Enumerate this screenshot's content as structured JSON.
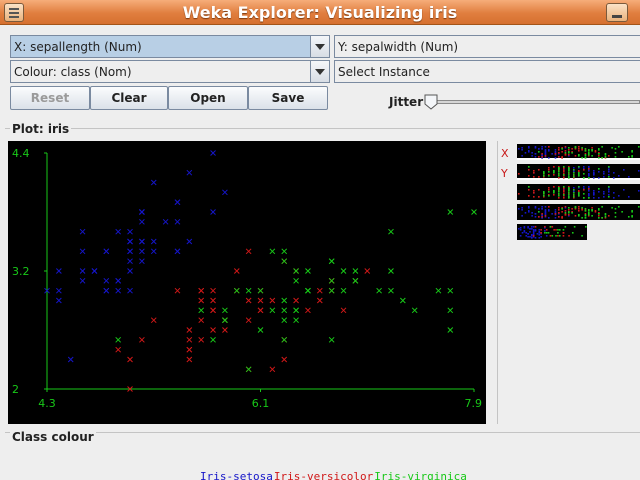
{
  "window": {
    "title": "Weka Explorer: Visualizing iris"
  },
  "controls": {
    "x_axis": "X: sepallength (Num)",
    "y_axis": "Y: sepalwidth (Num)",
    "colour": "Colour: class (Nom)",
    "select_instance": "Select Instance",
    "buttons": {
      "reset": "Reset",
      "clear": "Clear",
      "open": "Open",
      "save": "Save"
    },
    "jitter_label": "Jitter",
    "jitter_value": 0
  },
  "plot": {
    "title": "Plot: iris",
    "attr_x_label": "X",
    "attr_y_label": "Y"
  },
  "class_colour": {
    "title": "Class colour",
    "classes": [
      {
        "name": "Iris-setosa",
        "color": "#1515c8"
      },
      {
        "name": "Iris-versicolor",
        "color": "#d01818"
      },
      {
        "name": "Iris-virginica",
        "color": "#18c818"
      }
    ]
  },
  "chart_data": {
    "type": "scatter",
    "title": "Plot: iris",
    "xlabel": "sepallength",
    "ylabel": "sepalwidth",
    "xlim": [
      4.3,
      7.9
    ],
    "ylim": [
      2.0,
      4.4
    ],
    "x_ticks": [
      "4.3",
      "6.1",
      "7.9"
    ],
    "y_ticks": [
      "4.4",
      "3.2",
      "2"
    ],
    "marker": "x",
    "series": [
      {
        "name": "Iris-setosa",
        "color": "#1515c8",
        "points": [
          [
            5.1,
            3.5
          ],
          [
            4.9,
            3.0
          ],
          [
            4.7,
            3.2
          ],
          [
            4.6,
            3.1
          ],
          [
            5.0,
            3.6
          ],
          [
            5.4,
            3.9
          ],
          [
            4.6,
            3.4
          ],
          [
            5.0,
            3.4
          ],
          [
            4.4,
            2.9
          ],
          [
            4.9,
            3.1
          ],
          [
            5.4,
            3.7
          ],
          [
            4.8,
            3.4
          ],
          [
            4.8,
            3.0
          ],
          [
            4.3,
            3.0
          ],
          [
            5.8,
            4.0
          ],
          [
            5.7,
            4.4
          ],
          [
            5.4,
            3.9
          ],
          [
            5.1,
            3.5
          ],
          [
            5.7,
            3.8
          ],
          [
            5.1,
            3.8
          ],
          [
            5.4,
            3.4
          ],
          [
            5.1,
            3.7
          ],
          [
            4.6,
            3.6
          ],
          [
            5.1,
            3.3
          ],
          [
            4.8,
            3.4
          ],
          [
            5.0,
            3.0
          ],
          [
            5.0,
            3.4
          ],
          [
            5.2,
            3.5
          ],
          [
            5.2,
            3.4
          ],
          [
            4.7,
            3.2
          ],
          [
            4.8,
            3.1
          ],
          [
            5.4,
            3.4
          ],
          [
            5.2,
            4.1
          ],
          [
            5.5,
            4.2
          ],
          [
            4.9,
            3.1
          ],
          [
            5.0,
            3.2
          ],
          [
            5.5,
            3.5
          ],
          [
            4.9,
            3.6
          ],
          [
            4.4,
            3.0
          ],
          [
            5.1,
            3.4
          ],
          [
            5.0,
            3.5
          ],
          [
            4.5,
            2.3
          ],
          [
            4.4,
            3.2
          ],
          [
            5.0,
            3.5
          ],
          [
            5.1,
            3.8
          ],
          [
            4.8,
            3.0
          ],
          [
            5.1,
            3.8
          ],
          [
            4.6,
            3.2
          ],
          [
            5.3,
            3.7
          ],
          [
            5.0,
            3.3
          ]
        ]
      },
      {
        "name": "Iris-versicolor",
        "color": "#d01818",
        "points": [
          [
            7.0,
            3.2
          ],
          [
            6.4,
            3.2
          ],
          [
            6.9,
            3.1
          ],
          [
            5.5,
            2.3
          ],
          [
            6.5,
            2.8
          ],
          [
            5.7,
            2.8
          ],
          [
            6.3,
            3.3
          ],
          [
            4.9,
            2.4
          ],
          [
            6.6,
            2.9
          ],
          [
            5.2,
            2.7
          ],
          [
            5.0,
            2.0
          ],
          [
            5.9,
            3.0
          ],
          [
            6.0,
            2.2
          ],
          [
            6.1,
            2.9
          ],
          [
            5.6,
            2.9
          ],
          [
            6.7,
            3.1
          ],
          [
            5.6,
            3.0
          ],
          [
            5.8,
            2.7
          ],
          [
            6.2,
            2.2
          ],
          [
            5.6,
            2.5
          ],
          [
            5.9,
            3.2
          ],
          [
            6.1,
            2.8
          ],
          [
            6.3,
            2.5
          ],
          [
            6.1,
            2.8
          ],
          [
            6.4,
            2.9
          ],
          [
            6.6,
            3.0
          ],
          [
            6.8,
            2.8
          ],
          [
            6.7,
            3.0
          ],
          [
            6.0,
            2.9
          ],
          [
            5.7,
            2.6
          ],
          [
            5.5,
            2.4
          ],
          [
            5.5,
            2.4
          ],
          [
            5.8,
            2.7
          ],
          [
            6.0,
            2.7
          ],
          [
            5.4,
            3.0
          ],
          [
            6.0,
            3.4
          ],
          [
            6.7,
            3.1
          ],
          [
            6.3,
            2.3
          ],
          [
            5.6,
            3.0
          ],
          [
            5.5,
            2.5
          ],
          [
            5.5,
            2.6
          ],
          [
            6.1,
            3.0
          ],
          [
            5.8,
            2.6
          ],
          [
            5.0,
            2.3
          ],
          [
            5.6,
            2.7
          ],
          [
            5.7,
            3.0
          ],
          [
            5.7,
            2.9
          ],
          [
            6.2,
            2.9
          ],
          [
            5.1,
            2.5
          ],
          [
            5.7,
            2.8
          ]
        ]
      },
      {
        "name": "Iris-virginica",
        "color": "#18c818",
        "points": [
          [
            6.3,
            3.3
          ],
          [
            5.8,
            2.7
          ],
          [
            7.1,
            3.0
          ],
          [
            6.3,
            2.9
          ],
          [
            6.5,
            3.0
          ],
          [
            7.6,
            3.0
          ],
          [
            4.9,
            2.5
          ],
          [
            7.3,
            2.9
          ],
          [
            6.7,
            2.5
          ],
          [
            7.2,
            3.6
          ],
          [
            6.5,
            3.2
          ],
          [
            6.4,
            2.7
          ],
          [
            6.8,
            3.0
          ],
          [
            5.7,
            2.5
          ],
          [
            5.8,
            2.8
          ],
          [
            6.4,
            3.2
          ],
          [
            6.5,
            3.0
          ],
          [
            7.7,
            3.8
          ],
          [
            7.7,
            2.6
          ],
          [
            6.0,
            2.2
          ],
          [
            6.9,
            3.2
          ],
          [
            5.6,
            2.8
          ],
          [
            7.7,
            2.8
          ],
          [
            6.3,
            2.7
          ],
          [
            6.7,
            3.3
          ],
          [
            7.2,
            3.2
          ],
          [
            6.2,
            2.8
          ],
          [
            6.1,
            3.0
          ],
          [
            6.4,
            2.8
          ],
          [
            7.2,
            3.0
          ],
          [
            7.4,
            2.8
          ],
          [
            7.9,
            3.8
          ],
          [
            6.4,
            2.8
          ],
          [
            6.3,
            2.8
          ],
          [
            6.1,
            2.6
          ],
          [
            7.7,
            3.0
          ],
          [
            6.3,
            3.4
          ],
          [
            6.4,
            3.1
          ],
          [
            6.0,
            3.0
          ],
          [
            6.9,
            3.1
          ],
          [
            6.7,
            3.1
          ],
          [
            6.9,
            3.1
          ],
          [
            5.8,
            2.7
          ],
          [
            6.8,
            3.2
          ],
          [
            6.7,
            3.3
          ],
          [
            6.7,
            3.0
          ],
          [
            6.3,
            2.5
          ],
          [
            6.5,
            3.0
          ],
          [
            6.2,
            3.4
          ],
          [
            5.9,
            3.0
          ]
        ]
      }
    ]
  }
}
